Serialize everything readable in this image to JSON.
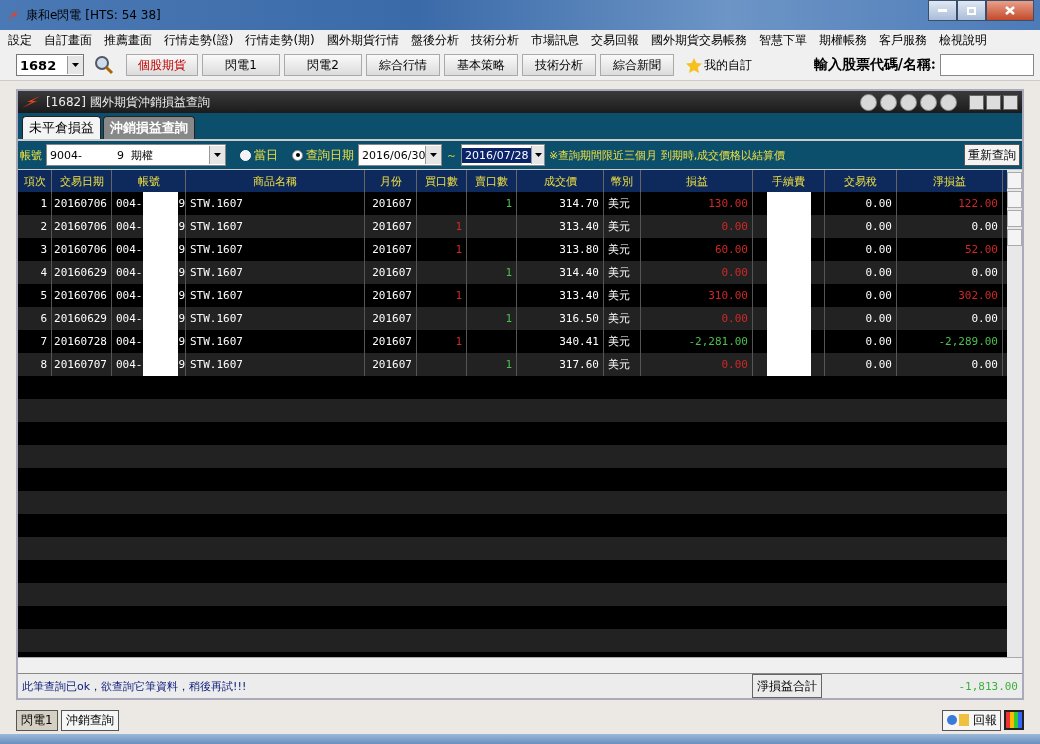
{
  "window": {
    "title": "康和e閃電  [HTS: 54 38]"
  },
  "menu": [
    "設定",
    "自訂畫面",
    "推薦畫面",
    "行情走勢(證)",
    "行情走勢(期)",
    "國外期貨行情",
    "盤後分析",
    "技術分析",
    "市場訊息",
    "交易回報",
    "國外期貨交易帳務",
    "智慧下單",
    "期權帳務",
    "客戶服務",
    "檢視說明"
  ],
  "toolbar": {
    "code": "1682",
    "buttons": [
      {
        "label": "個股期貨",
        "highlight": true
      },
      {
        "label": "閃電1",
        "highlight": false
      },
      {
        "label": "閃電2",
        "highlight": false
      },
      {
        "label": "綜合行情",
        "highlight": false
      },
      {
        "label": "基本策略",
        "highlight": false
      },
      {
        "label": "技術分析",
        "highlight": false
      },
      {
        "label": "綜合新聞",
        "highlight": false
      }
    ],
    "favorites": "我的自訂",
    "search_label": "輸入股票代碼/名稱:"
  },
  "child": {
    "title": "[1682] 國外期貨沖銷損益查詢",
    "tabs": [
      {
        "label": "未平倉損益",
        "selected": false
      },
      {
        "label": "沖銷損益查詢",
        "selected": true
      }
    ],
    "filter": {
      "account_label": "帳號",
      "account": "9004-          9  期權",
      "radios": [
        {
          "label": "當日",
          "selected": false
        },
        {
          "label": "查詢日期",
          "selected": true
        }
      ],
      "date_from": "2016/06/30",
      "tilde": "～",
      "date_to": "2016/07/28",
      "note": "※查詢期間限近三個月 到期時,成交價格以結算價",
      "refresh": "重新查詢"
    },
    "table": {
      "columns": [
        "項次",
        "交易日期",
        "帳號",
        "商品名稱",
        "月份",
        "買口數",
        "賣口數",
        "成交價",
        "幣別",
        "損益",
        "手續費",
        "交易稅",
        "淨損益"
      ],
      "rows": [
        {
          "no": "1",
          "date": "20160706",
          "account_start": "004-",
          "account_end": "9",
          "product": "STW.1607",
          "month": "201607",
          "buy": "",
          "sell": "1",
          "price": "314.70",
          "currency": "美元",
          "pnl": {
            "text": "130.00",
            "color": "#d02828"
          },
          "tax": "0.00",
          "net": {
            "text": "122.00",
            "color": "#d02828"
          }
        },
        {
          "no": "2",
          "date": "20160706",
          "account_start": "004-",
          "account_end": "9",
          "product": "STW.1607",
          "month": "201607",
          "buy": "1",
          "sell": "",
          "price": "313.40",
          "currency": "美元",
          "pnl": {
            "text": "0.00",
            "color": "#d02828"
          },
          "tax": "0.00",
          "net": {
            "text": "0.00",
            "color": "#ffffff"
          }
        },
        {
          "no": "3",
          "date": "20160706",
          "account_start": "004-",
          "account_end": "9",
          "product": "STW.1607",
          "month": "201607",
          "buy": "1",
          "sell": "",
          "price": "313.80",
          "currency": "美元",
          "pnl": {
            "text": "60.00",
            "color": "#d02828"
          },
          "tax": "0.00",
          "net": {
            "text": "52.00",
            "color": "#d02828"
          }
        },
        {
          "no": "4",
          "date": "20160629",
          "account_start": "004-",
          "account_end": "9",
          "product": "STW.1607",
          "month": "201607",
          "buy": "",
          "sell": "1",
          "price": "314.40",
          "currency": "美元",
          "pnl": {
            "text": "0.00",
            "color": "#d02828"
          },
          "tax": "0.00",
          "net": {
            "text": "0.00",
            "color": "#ffffff"
          }
        },
        {
          "no": "5",
          "date": "20160706",
          "account_start": "004-",
          "account_end": "9",
          "product": "STW.1607",
          "month": "201607",
          "buy": "1",
          "sell": "",
          "price": "313.40",
          "currency": "美元",
          "pnl": {
            "text": "310.00",
            "color": "#d02828"
          },
          "tax": "0.00",
          "net": {
            "text": "302.00",
            "color": "#d02828"
          }
        },
        {
          "no": "6",
          "date": "20160629",
          "account_start": "004-",
          "account_end": "9",
          "product": "STW.1607",
          "month": "201607",
          "buy": "",
          "sell": "1",
          "price": "316.50",
          "currency": "美元",
          "pnl": {
            "text": "0.00",
            "color": "#d02828"
          },
          "tax": "0.00",
          "net": {
            "text": "0.00",
            "color": "#ffffff"
          }
        },
        {
          "no": "7",
          "date": "20160728",
          "account_start": "004-",
          "account_end": "9",
          "product": "STW.1607",
          "month": "201607",
          "buy": "1",
          "sell": "",
          "price": "340.41",
          "currency": "美元",
          "pnl": {
            "text": "-2,281.00",
            "color": "#4cc04c"
          },
          "tax": "0.00",
          "net": {
            "text": "-2,289.00",
            "color": "#4cc04c"
          }
        },
        {
          "no": "8",
          "date": "20160707",
          "account_start": "004-",
          "account_end": "9",
          "product": "STW.1607",
          "month": "201607",
          "buy": "",
          "sell": "1",
          "price": "317.60",
          "currency": "美元",
          "pnl": {
            "text": "0.00",
            "color": "#d02828"
          },
          "tax": "0.00",
          "net": {
            "text": "0.00",
            "color": "#ffffff"
          }
        }
      ]
    },
    "status": {
      "message": "此筆查詢已ok，欲查詢它筆資料，稍後再試!!!",
      "total_label": "淨損益合計",
      "total": "-1,813.00"
    }
  },
  "bottom_tabs": [
    {
      "label": "閃電1",
      "selected": true
    },
    {
      "label": "沖銷查詢",
      "selected": false
    }
  ],
  "bottom_right": "回報"
}
